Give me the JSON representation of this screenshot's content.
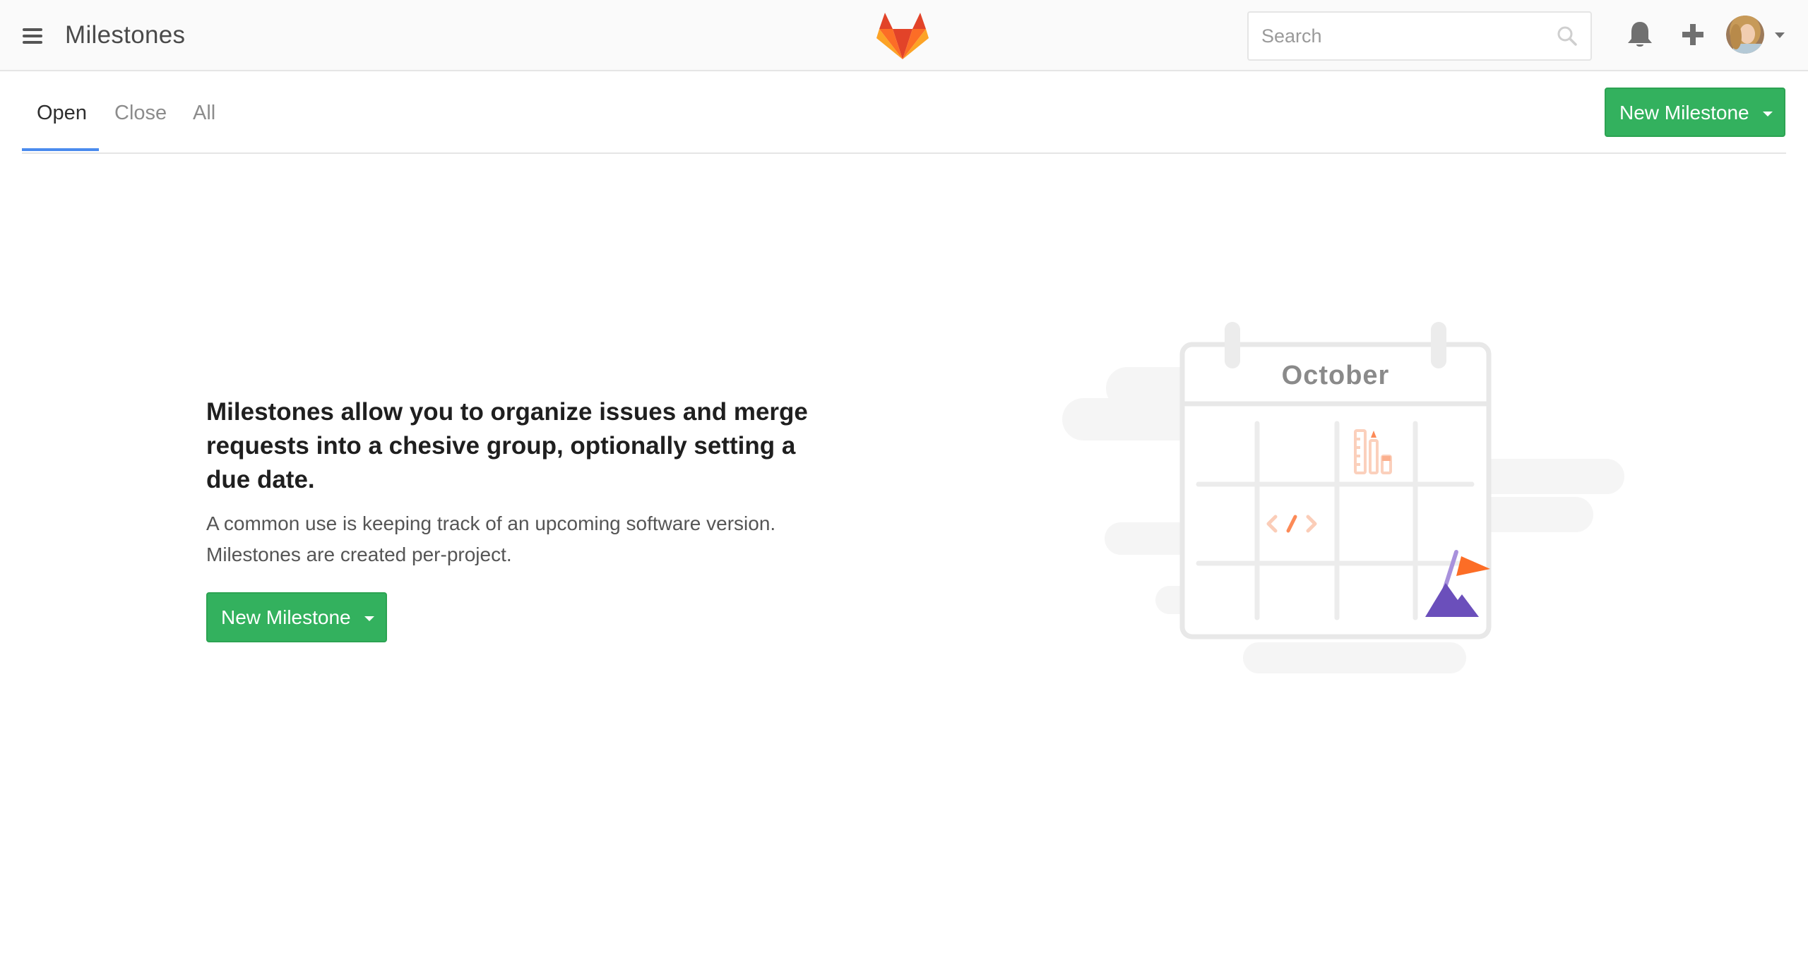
{
  "header": {
    "title": "Milestones",
    "search": {
      "placeholder": "Search",
      "value": ""
    },
    "icons": {
      "menu": "hamburger-menu-icon",
      "logo": "gitlab-tanuki-logo",
      "search": "search-icon",
      "notifications": "bell-icon",
      "create": "plus-icon",
      "user": "avatar"
    }
  },
  "tabs": [
    {
      "label": "Open",
      "active": true
    },
    {
      "label": "Close",
      "active": false
    },
    {
      "label": "All",
      "active": false
    }
  ],
  "toolbar": {
    "new_milestone_label": "New Milestone"
  },
  "empty_state": {
    "heading": "Milestones allow you to organize issues and merge requests into a chesive group, optionally setting a due date.",
    "description_line1": "A common use is keeping track of an upcoming software version.",
    "description_line2": "Milestones are created per-project.",
    "button_label": "New Milestone",
    "illustration": {
      "month": "October"
    }
  },
  "colors": {
    "primary_green": "#33b15e",
    "tab_active_underline": "#4a8bee",
    "logo_orange": "#fc6d26",
    "logo_red": "#e24329",
    "logo_yellow": "#fca326",
    "flag_orange": "#fc6d26",
    "mountain_purple": "#6b4fbb"
  }
}
